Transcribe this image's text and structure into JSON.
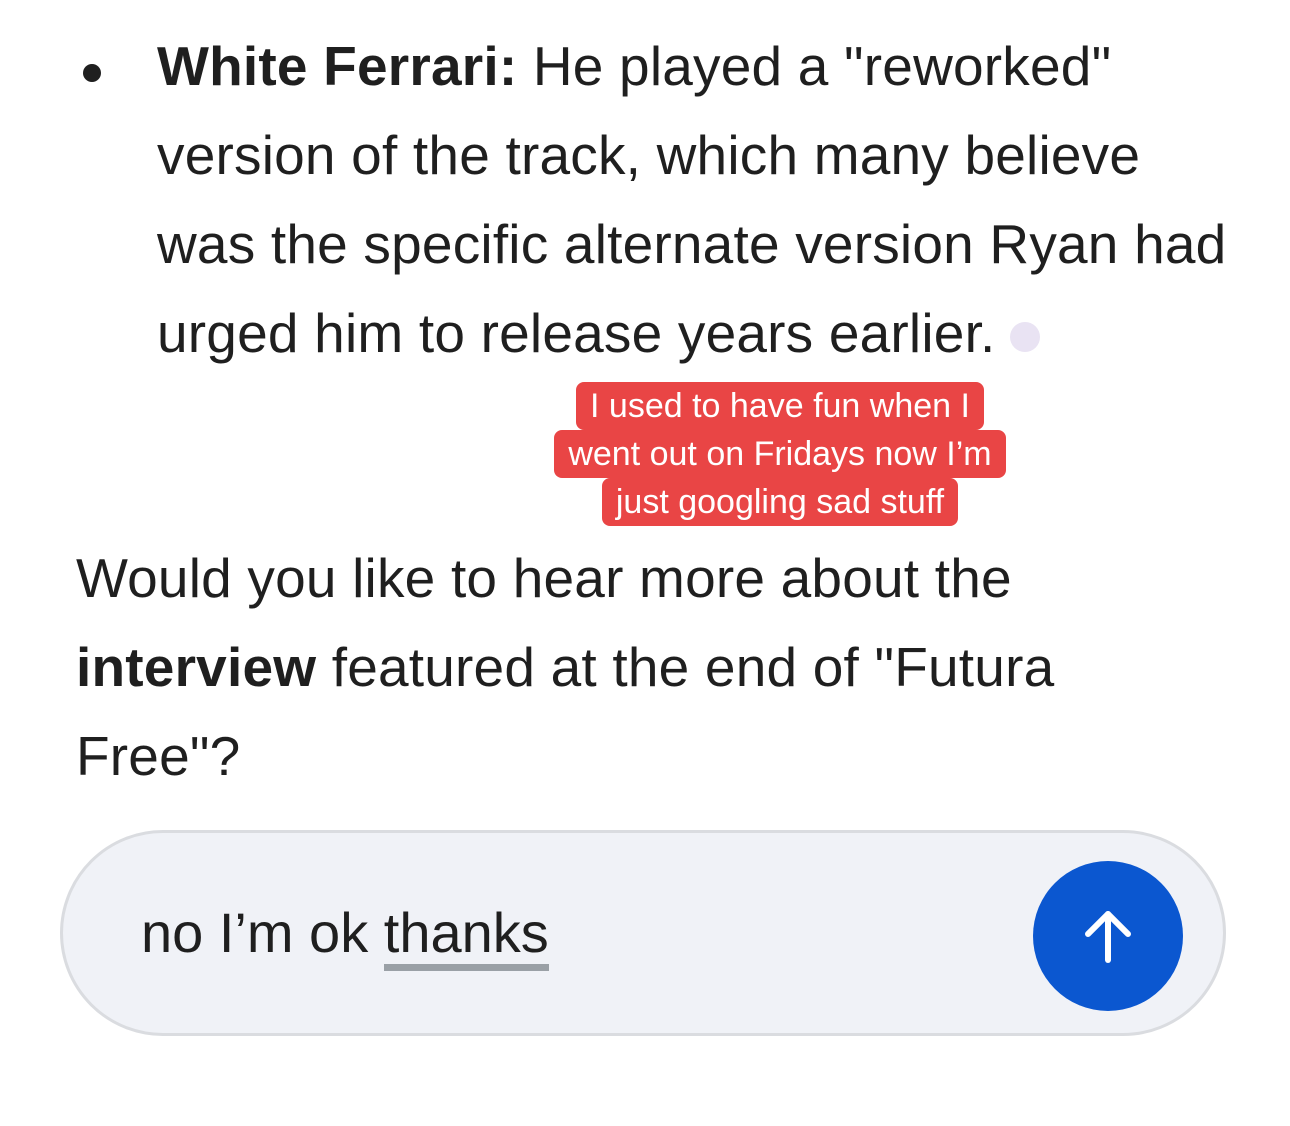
{
  "response": {
    "bullet": {
      "label": "White Ferrari:",
      "text_line1": " He played a \"reworked\"",
      "text_rest": "version of the track, which many believe was the specific alternate version Ryan had urged him to release years earlier."
    },
    "question": {
      "before": "Would you like to hear more about the ",
      "bold": "interview",
      "after": " featured at the end of \"Futura Free\"?"
    }
  },
  "caption_overlay": {
    "line1": "I used to have fun when I",
    "line2": "went out on Fridays now I’m",
    "line3": "just googling sad stuff"
  },
  "composer": {
    "typed_plain": "no I’m ok ",
    "typed_underlined": "thanks",
    "send_icon": "arrow-up-icon"
  },
  "colors": {
    "send_button": "#0b57d0",
    "caption_bg": "#e94545",
    "composer_bg": "#f0f2f7"
  }
}
